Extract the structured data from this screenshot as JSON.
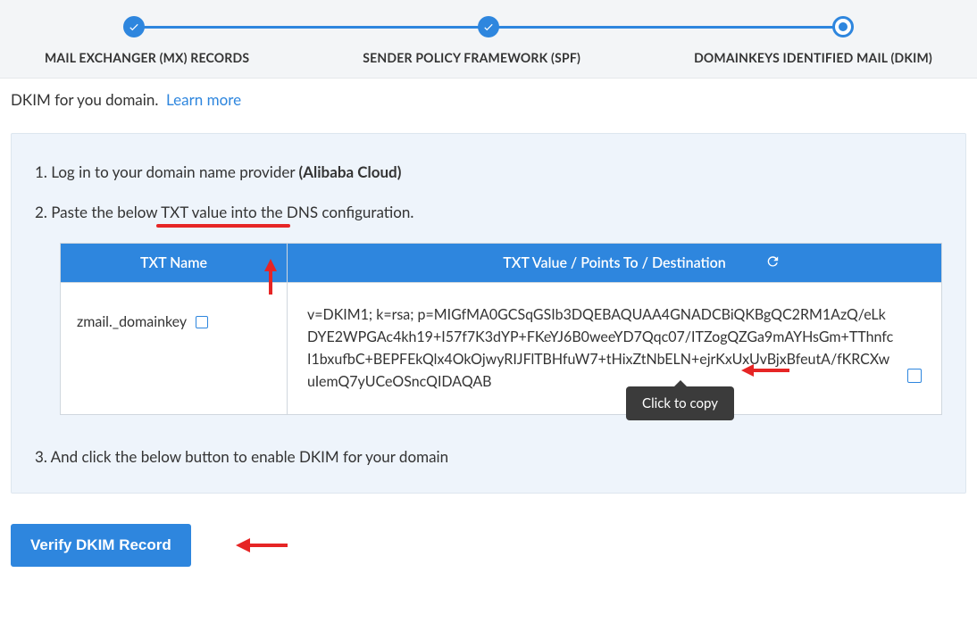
{
  "stepper": {
    "steps": [
      {
        "label": "MAIL EXCHANGER (MX) RECORDS",
        "state": "done"
      },
      {
        "label": "SENDER POLICY FRAMEWORK (SPF)",
        "state": "done"
      },
      {
        "label": "DOMAINKEYS IDENTIFIED MAIL (DKIM)",
        "state": "current"
      }
    ]
  },
  "intro": {
    "text_fragment": "DKIM for you domain.",
    "learn_more": "Learn more"
  },
  "instructions": {
    "step1_prefix": "1. Log in to your domain name provider ",
    "step1_provider": "(Alibaba Cloud)",
    "step2": "2. Paste the below TXT value into the DNS configuration.",
    "step3": "3. And click the below button to enable DKIM for your domain"
  },
  "dns_table": {
    "headers": {
      "name": "TXT Name",
      "value": "TXT Value / Points To / Destination"
    },
    "row": {
      "name": "zmail._domainkey",
      "value": "v=DKIM1; k=rsa; p=MIGfMA0GCSqGSIb3DQEBAQUAA4GNADCBiQKBgQC2RM1AzQ/eLkDYE2WPGAc4kh19+I57f7K3dYP+FKeYJ6B0weeYD7Qqc07/ITZogQZGa9mAYHsGm+TThnfcI1bxufbC+BEPFEkQlx4OkOjwyRIJFlTBHfuW7+tHixZtNbELN+ejrKxUxUvBjxBfeutA/fKRCXwuIemQ7yUCeOSncQIDAQAB"
    }
  },
  "tooltip": {
    "copy": "Click to copy"
  },
  "buttons": {
    "verify": "Verify DKIM Record"
  }
}
